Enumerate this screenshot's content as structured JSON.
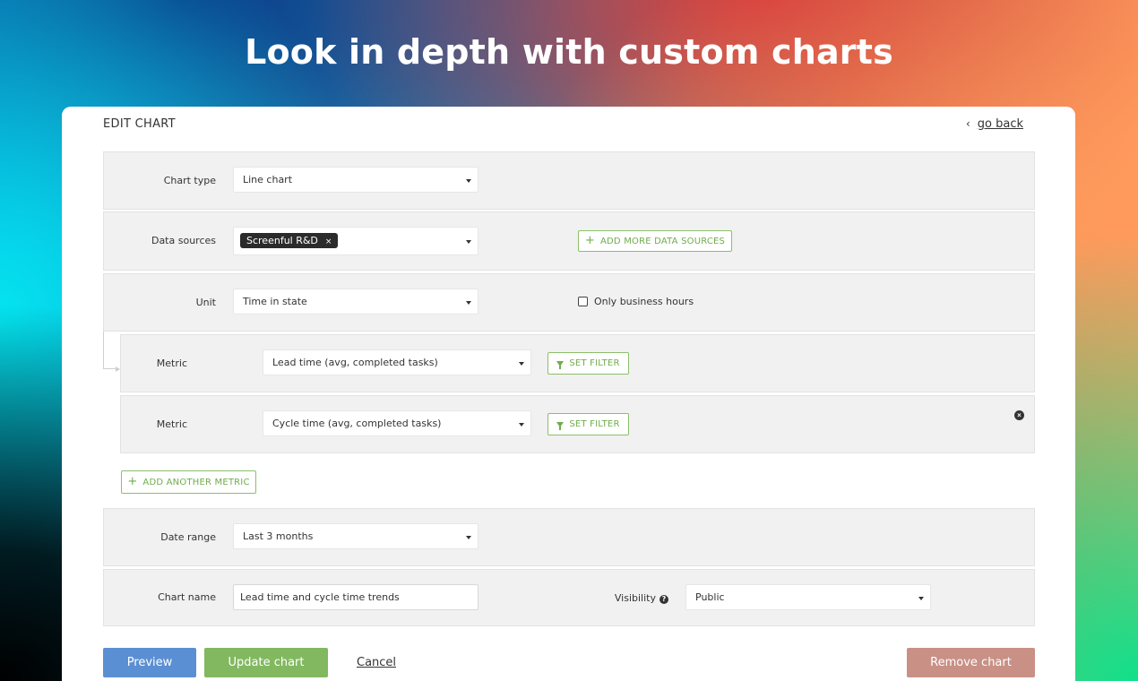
{
  "headline": "Look in depth with custom charts",
  "header": {
    "title": "EDIT CHART",
    "go_back": "go back"
  },
  "chart_type": {
    "label": "Chart type",
    "value": "Line chart"
  },
  "data_sources": {
    "label": "Data sources",
    "chips": [
      "Screenful R&D"
    ],
    "chip_remove": "×",
    "add_button": "ADD MORE DATA SOURCES"
  },
  "unit": {
    "label": "Unit",
    "value": "Time in state",
    "checkbox_label": "Only business hours",
    "checkbox_checked": false
  },
  "metrics": [
    {
      "label": "Metric",
      "value": "Lead time (avg, completed tasks)",
      "filter_button": "SET FILTER"
    },
    {
      "label": "Metric",
      "value": "Cycle time (avg, completed tasks)",
      "filter_button": "SET FILTER"
    }
  ],
  "add_metric_button": "ADD ANOTHER METRIC",
  "date_range": {
    "label": "Date range",
    "value": "Last 3 months"
  },
  "chart_name": {
    "label": "Chart name",
    "value": "Lead time and cycle time trends"
  },
  "visibility": {
    "label": "Visibility",
    "value": "Public",
    "help_glyph": "?"
  },
  "actions": {
    "preview": "Preview",
    "update": "Update chart",
    "cancel": "Cancel",
    "remove": "Remove chart"
  },
  "icons": {
    "plus": "+",
    "close": "×",
    "back_chevron": "‹"
  },
  "colors": {
    "preview": "#5b8fd4",
    "update": "#82b860",
    "remove": "#c99086",
    "accent_green": "#6fad4a"
  }
}
